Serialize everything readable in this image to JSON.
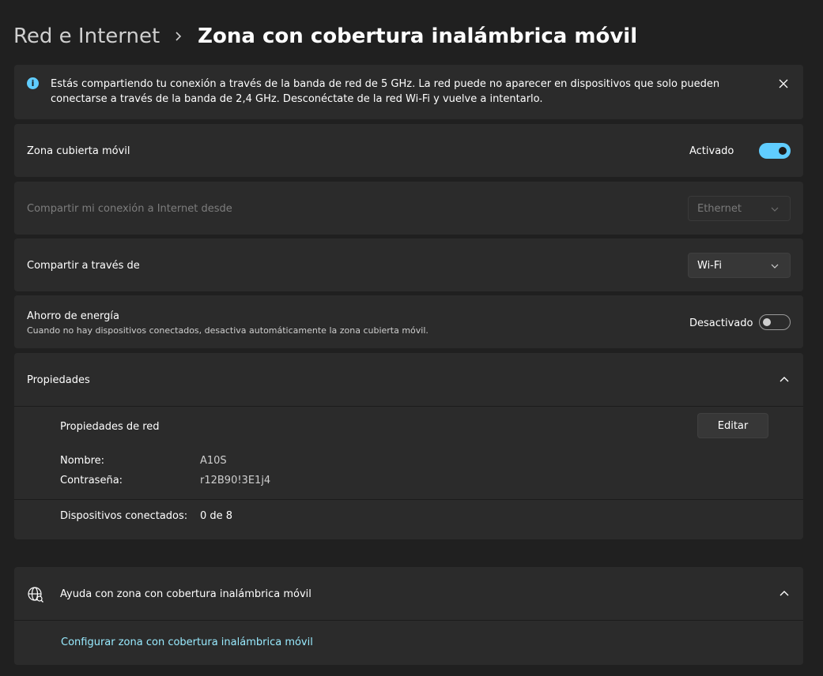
{
  "breadcrumb": {
    "parent": "Red e Internet",
    "current": "Zona con cobertura inalámbrica móvil"
  },
  "info_bar": {
    "text": "Estás compartiendo tu conexión a través de la banda de red de 5 GHz. La red puede no aparecer en dispositivos que solo pueden conectarse a través de la banda de 2,4 GHz. Desconéctate de la red Wi-Fi y vuelve a intentarlo."
  },
  "hotspot": {
    "label": "Zona cubierta móvil",
    "state": "Activado",
    "enabled": true
  },
  "share_from": {
    "label": "Compartir mi conexión a Internet desde",
    "value": "Ethernet",
    "disabled": true
  },
  "share_over": {
    "label": "Compartir a través de",
    "value": "Wi-Fi"
  },
  "power_saving": {
    "label": "Ahorro de energía",
    "description": "Cuando no hay dispositivos conectados, desactiva automáticamente la zona cubierta móvil.",
    "state": "Desactivado",
    "enabled": false
  },
  "properties": {
    "header": "Propiedades",
    "network_props_label": "Propiedades de red",
    "edit_label": "Editar",
    "name_label": "Nombre:",
    "name_value": "A10S",
    "password_label": "Contraseña:",
    "password_value": "r12B90!3E1j4",
    "devices_label": "Dispositivos conectados:",
    "devices_value": "0 de 8"
  },
  "help": {
    "header": "Ayuda con zona con cobertura inalámbrica móvil",
    "link": "Configurar zona con cobertura inalámbrica móvil"
  },
  "colors": {
    "accent": "#60cdff",
    "link": "#99ebff",
    "background": "#202020",
    "card": "#2b2b2b"
  }
}
